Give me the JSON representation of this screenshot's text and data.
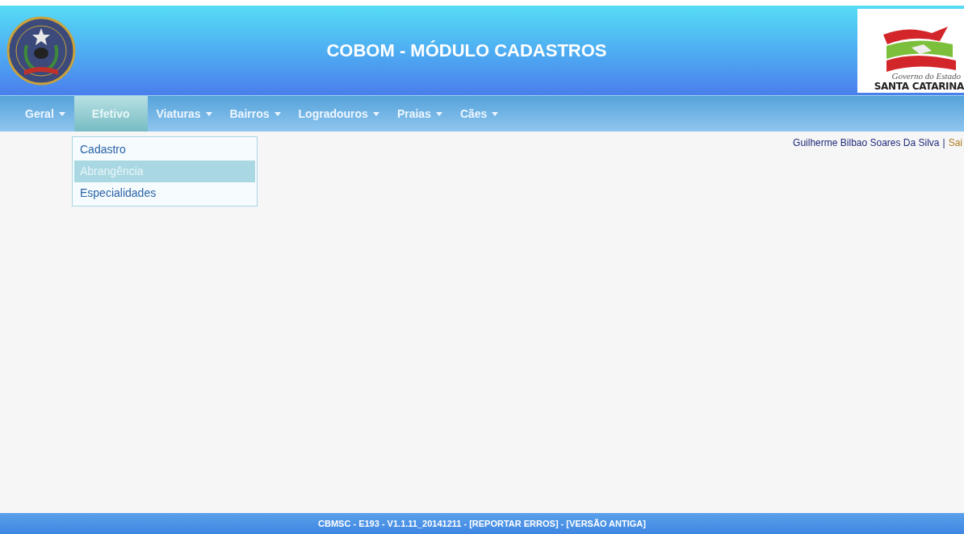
{
  "header": {
    "title": "COBOM - MÓDULO CADASTROS",
    "state_logo": {
      "line_1": "Governo do Estado",
      "line_2": "SANTA CATARINA"
    }
  },
  "nav": [
    {
      "label": "Geral",
      "caret": true,
      "selected": false
    },
    {
      "label": "Efetivo",
      "caret": false,
      "selected": true
    },
    {
      "label": "Viaturas",
      "caret": true,
      "selected": false
    },
    {
      "label": "Bairros",
      "caret": true,
      "selected": false
    },
    {
      "label": "Logradouros",
      "caret": true,
      "selected": false
    },
    {
      "label": "Praias",
      "caret": true,
      "selected": false
    },
    {
      "label": "Cães",
      "caret": true,
      "selected": false
    }
  ],
  "dropdown": [
    {
      "label": "Cadastro",
      "selected": false
    },
    {
      "label": "Abrangência",
      "selected": true
    },
    {
      "label": "Especialidades",
      "selected": false
    }
  ],
  "user": {
    "name": "Guilherme Bilbao Soares Da Silva",
    "separator": "|",
    "logout": "Sai"
  },
  "footer": "CBMSC - E193 - V1.1.11_20141211 - [REPORTAR ERROS] - [VERSÃO ANTIGA]"
}
